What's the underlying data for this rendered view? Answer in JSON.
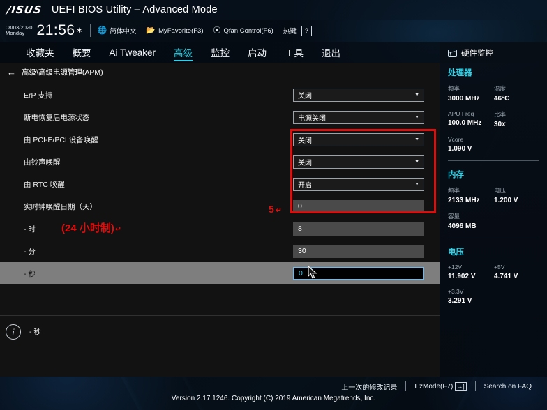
{
  "titlebar": {
    "logo": "/ISUS",
    "title": "UEFI BIOS Utility – Advanced Mode"
  },
  "infobar": {
    "date": "08/03/2020",
    "weekday": "Monday",
    "time": "21:56",
    "gear_icon": "gear-icon",
    "language": "简体中文",
    "myfavorite": "MyFavorite(F3)",
    "qfan": "Qfan Control(F6)",
    "hotkey_label": "热键",
    "hotkey_key": "?"
  },
  "tabs": [
    {
      "label": "收藏夹",
      "active": false
    },
    {
      "label": "概要",
      "active": false
    },
    {
      "label": "Ai Tweaker",
      "active": false
    },
    {
      "label": "高级",
      "active": true
    },
    {
      "label": "监控",
      "active": false
    },
    {
      "label": "启动",
      "active": false
    },
    {
      "label": "工具",
      "active": false
    },
    {
      "label": "退出",
      "active": false
    }
  ],
  "breadcrumb": "高级\\高级电源管理(APM)",
  "settings": [
    {
      "label": "ErP 支持",
      "type": "dropdown",
      "value": "关闭",
      "selected": false
    },
    {
      "label": "断电恢复后电源状态",
      "type": "dropdown",
      "value": "电源关闭",
      "selected": false
    },
    {
      "label": "由 PCI-E/PCI 设备唤醒",
      "type": "dropdown",
      "value": "关闭",
      "selected": false
    },
    {
      "label": "由铃声唤醒",
      "type": "dropdown",
      "value": "关闭",
      "selected": false
    },
    {
      "label": "由 RTC 唤醒",
      "type": "dropdown",
      "value": "开启",
      "selected": false
    },
    {
      "label": "实时钟唤醒日期（天）",
      "type": "text",
      "value": "0",
      "selected": false
    },
    {
      "label": "- 时",
      "type": "text",
      "value": "8",
      "selected": false
    },
    {
      "label": "- 分",
      "type": "text",
      "value": "30",
      "selected": false
    },
    {
      "label": "- 秒",
      "type": "text",
      "value": "0",
      "selected": true
    }
  ],
  "annotations": {
    "step_number": "5",
    "step_return": "↵",
    "note": "(24 小时制)",
    "note_return": "↵",
    "box_color": "#e00d0d"
  },
  "help": {
    "info_icon": "info-icon",
    "text": "- 秒"
  },
  "sidebar": {
    "title": "硬件监控",
    "title_icon": "monitor-icon",
    "sections": [
      {
        "name": "处理器",
        "pairs": [
          {
            "cap1": "频率",
            "val1": "3000 MHz",
            "cap2": "温度",
            "val2": "46°C"
          },
          {
            "cap1": "APU Freq",
            "val1": "100.0 MHz",
            "cap2": "比率",
            "val2": "30x"
          },
          {
            "cap1": "Vcore",
            "val1": "1.090 V",
            "cap2": "",
            "val2": ""
          }
        ]
      },
      {
        "name": "内存",
        "pairs": [
          {
            "cap1": "频率",
            "val1": "2133 MHz",
            "cap2": "电压",
            "val2": "1.200 V"
          },
          {
            "cap1": "容量",
            "val1": "4096 MB",
            "cap2": "",
            "val2": ""
          }
        ]
      },
      {
        "name": "电压",
        "pairs": [
          {
            "cap1": "+12V",
            "val1": "11.902 V",
            "cap2": "+5V",
            "val2": "4.741 V"
          },
          {
            "cap1": "+3.3V",
            "val1": "3.291 V",
            "cap2": "",
            "val2": ""
          }
        ]
      }
    ]
  },
  "bottombar": {
    "last_modified": "上一次的修改记录",
    "ezmode": "EzMode(F7)",
    "ezmode_key": "→]",
    "search_faq": "Search on FAQ"
  },
  "copyright": "Version 2.17.1246. Copyright (C) 2019 American Megatrends, Inc.",
  "colors": {
    "accent": "#2fd2e8",
    "annotation_red": "#e00d0d",
    "selected_row": "#7e7e7e",
    "focus_border": "#7fb4d8"
  }
}
